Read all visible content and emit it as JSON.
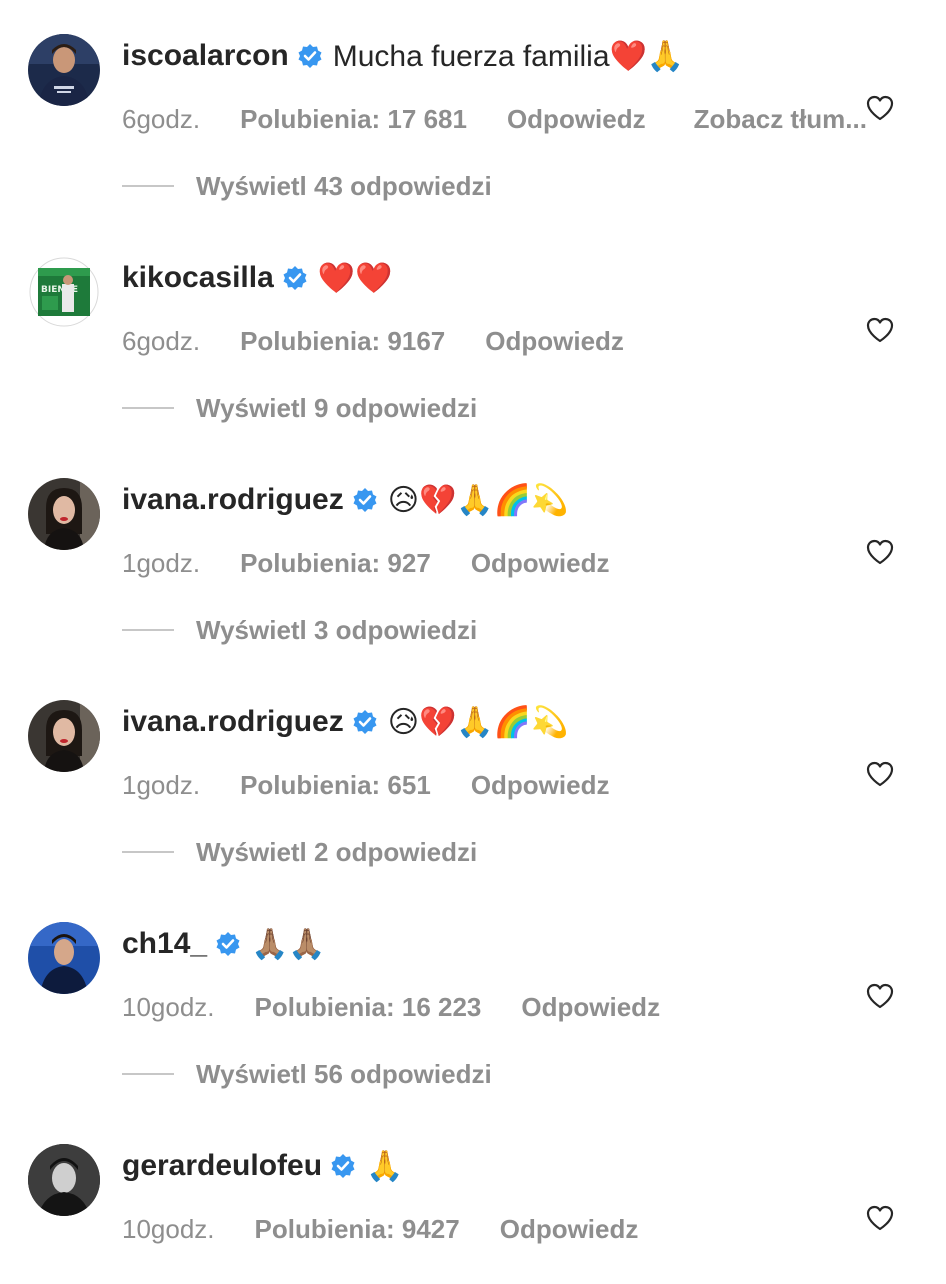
{
  "comments": [
    {
      "username": "iscoalarcon",
      "text": "Mucha fuerza familia❤️🙏",
      "time": "6godz.",
      "likes": "Polubienia: 17 681",
      "reply": "Odpowiedz",
      "translate": "Zobacz tłum...",
      "view_replies": "Wyświetl 43 odpowiedzi",
      "avatar_icon": "avatar-player-icon"
    },
    {
      "username": "kikocasilla",
      "text": "❤️❤️",
      "time": "6godz.",
      "likes": "Polubienia: 9167",
      "reply": "Odpowiedz",
      "view_replies": "Wyświetl 9 odpowiedzi",
      "avatar_icon": "avatar-green-badge-icon"
    },
    {
      "username": "ivana.rodriguez",
      "text": "😥💔🙏🌈💫",
      "time": "1godz.",
      "likes": "Polubienia: 927",
      "reply": "Odpowiedz",
      "view_replies": "Wyświetl 3 odpowiedzi",
      "avatar_icon": "avatar-woman-icon"
    },
    {
      "username": "ivana.rodriguez",
      "text": "😥💔🙏🌈💫",
      "time": "1godz.",
      "likes": "Polubienia: 651",
      "reply": "Odpowiedz",
      "view_replies": "Wyświetl 2 odpowiedzi",
      "avatar_icon": "avatar-woman-icon"
    },
    {
      "username": "ch14_",
      "text": "🙏🏽🙏🏽",
      "time": "10godz.",
      "likes": "Polubienia: 16 223",
      "reply": "Odpowiedz",
      "view_replies": "Wyświetl 56 odpowiedzi",
      "avatar_icon": "avatar-man-blue-icon"
    },
    {
      "username": "gerardeulofeu",
      "text": "🙏",
      "time": "10godz.",
      "likes": "Polubienia: 9427",
      "reply": "Odpowiedz",
      "avatar_icon": "avatar-man-bw-icon"
    }
  ],
  "colors": {
    "text_primary": "#262626",
    "text_secondary": "#8e8e8e",
    "verified_blue": "#3897f0",
    "divider": "#c7c7c7"
  }
}
